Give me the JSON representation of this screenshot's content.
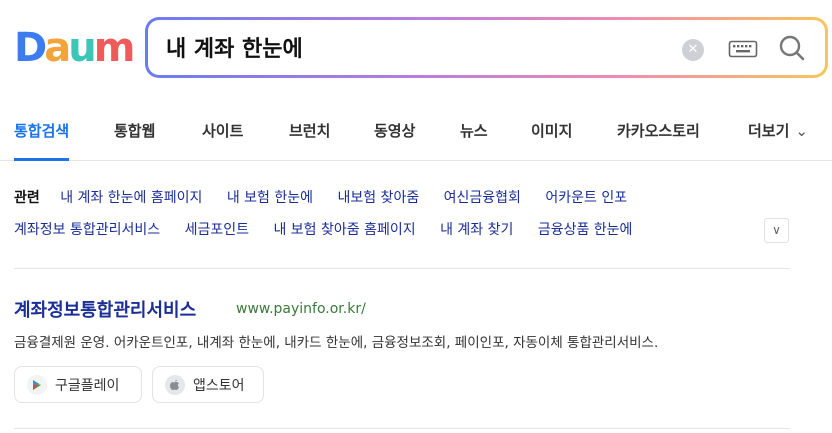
{
  "logo": {
    "letters": [
      "D",
      "a",
      "u",
      "m"
    ],
    "colors": [
      "#3d7bf0",
      "#f2a43a",
      "#3cc6b8",
      "#ee5b5b"
    ]
  },
  "search": {
    "value": "내 계좌 한눈에",
    "clear_icon": "close-icon",
    "keyboard_icon": "keyboard-icon",
    "search_icon": "search-icon"
  },
  "tabs": [
    {
      "label": "통합검색",
      "active": true
    },
    {
      "label": "통합웹"
    },
    {
      "label": "사이트"
    },
    {
      "label": "브런치"
    },
    {
      "label": "동영상"
    },
    {
      "label": "뉴스"
    },
    {
      "label": "이미지"
    },
    {
      "label": "카카오스토리"
    },
    {
      "label": "더보기"
    }
  ],
  "related": {
    "title": "관련",
    "row1": [
      "내 계좌 한눈에 홈페이지",
      "내 보험 한눈에",
      "내보험 찾아줌",
      "여신금융협회",
      "어카운트 인포"
    ],
    "row2": [
      "계좌정보 통합관리서비스",
      "세금포인트",
      "내 보험 찾아줌 홈페이지",
      "내 계좌 찾기",
      "금융상품 한눈에"
    ]
  },
  "result": {
    "title": "계좌정보통합관리서비스",
    "url": "www.payinfo.or.kr/",
    "description": "금융결제원 운영. 어카운트인포, 내계좌 한눈에, 내카드 한눈에, 금융정보조회, 페이인포, 자동이체 통합관리서비스.",
    "apps": [
      {
        "label": "구글플레이",
        "icon": "google-play-icon"
      },
      {
        "label": "앱스토어",
        "icon": "apple-icon"
      }
    ]
  },
  "colors": {
    "accent": "#1a73e8",
    "link": "#1b2e98",
    "url": "#3a7a3a"
  }
}
